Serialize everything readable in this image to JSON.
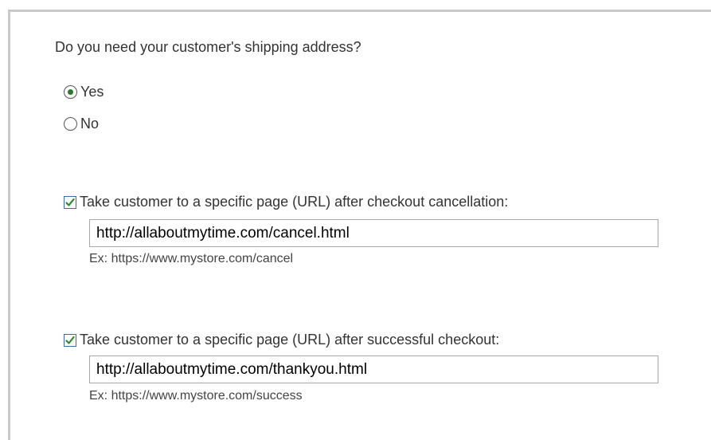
{
  "shipping": {
    "question": "Do you need your customer's shipping address?",
    "options": [
      {
        "label": "Yes",
        "selected": true
      },
      {
        "label": "No",
        "selected": false
      }
    ]
  },
  "cancel_redirect": {
    "checked": true,
    "label": "Take customer to a specific page (URL) after checkout cancellation:",
    "value": "http://allaboutmytime.com/cancel.html",
    "example": "Ex: https://www.mystore.com/cancel"
  },
  "success_redirect": {
    "checked": true,
    "label": "Take customer to a specific page (URL) after successful checkout:",
    "value": "http://allaboutmytime.com/thankyou.html",
    "example": "Ex: https://www.mystore.com/success"
  },
  "colors": {
    "checkmark": "#2a8a2a",
    "radio_dot": "#2a7a2a",
    "frame_border": "#c9c9c9"
  }
}
